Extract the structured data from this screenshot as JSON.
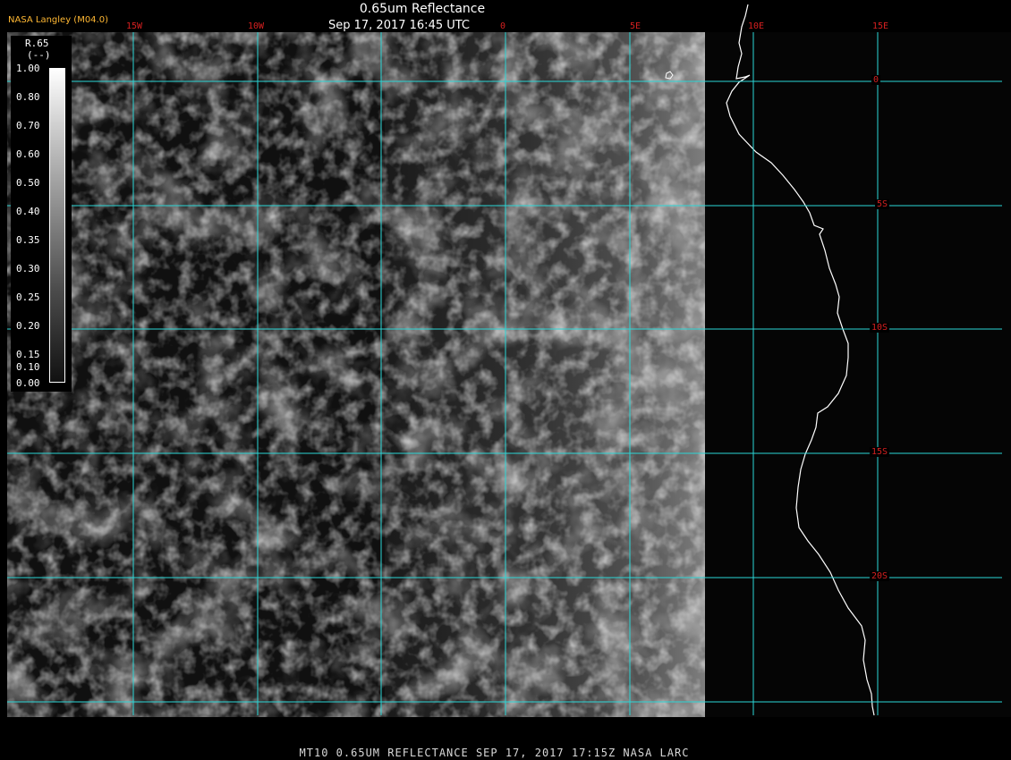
{
  "header": {
    "title": "0.65um Reflectance",
    "subtitle": "Sep 17, 2017 16:45 UTC",
    "org_label": "NASA Langley (M04.0)"
  },
  "footer": {
    "text": "MT10  0.65UM REFLECTANCE   SEP 17, 2017 17:15Z   NASA LARC"
  },
  "legend": {
    "title": "R.65",
    "units": "(--)",
    "ticks": [
      "1.00",
      "0.80",
      "0.70",
      "0.60",
      "0.50",
      "0.40",
      "0.35",
      "0.30",
      "0.25",
      "0.20",
      "0.15",
      "0.10",
      "0.00"
    ]
  },
  "grid": {
    "longitude_labels": [
      "15W",
      "10W",
      "0",
      "5E",
      "10E",
      "15E"
    ],
    "latitude_labels": [
      "0",
      "5S",
      "10S",
      "15S",
      "20S"
    ]
  },
  "colors": {
    "grid_line": "#2bd6d6",
    "grid_label": "#d62020",
    "org_label": "#ffb833",
    "coastline": "#ffffff"
  }
}
